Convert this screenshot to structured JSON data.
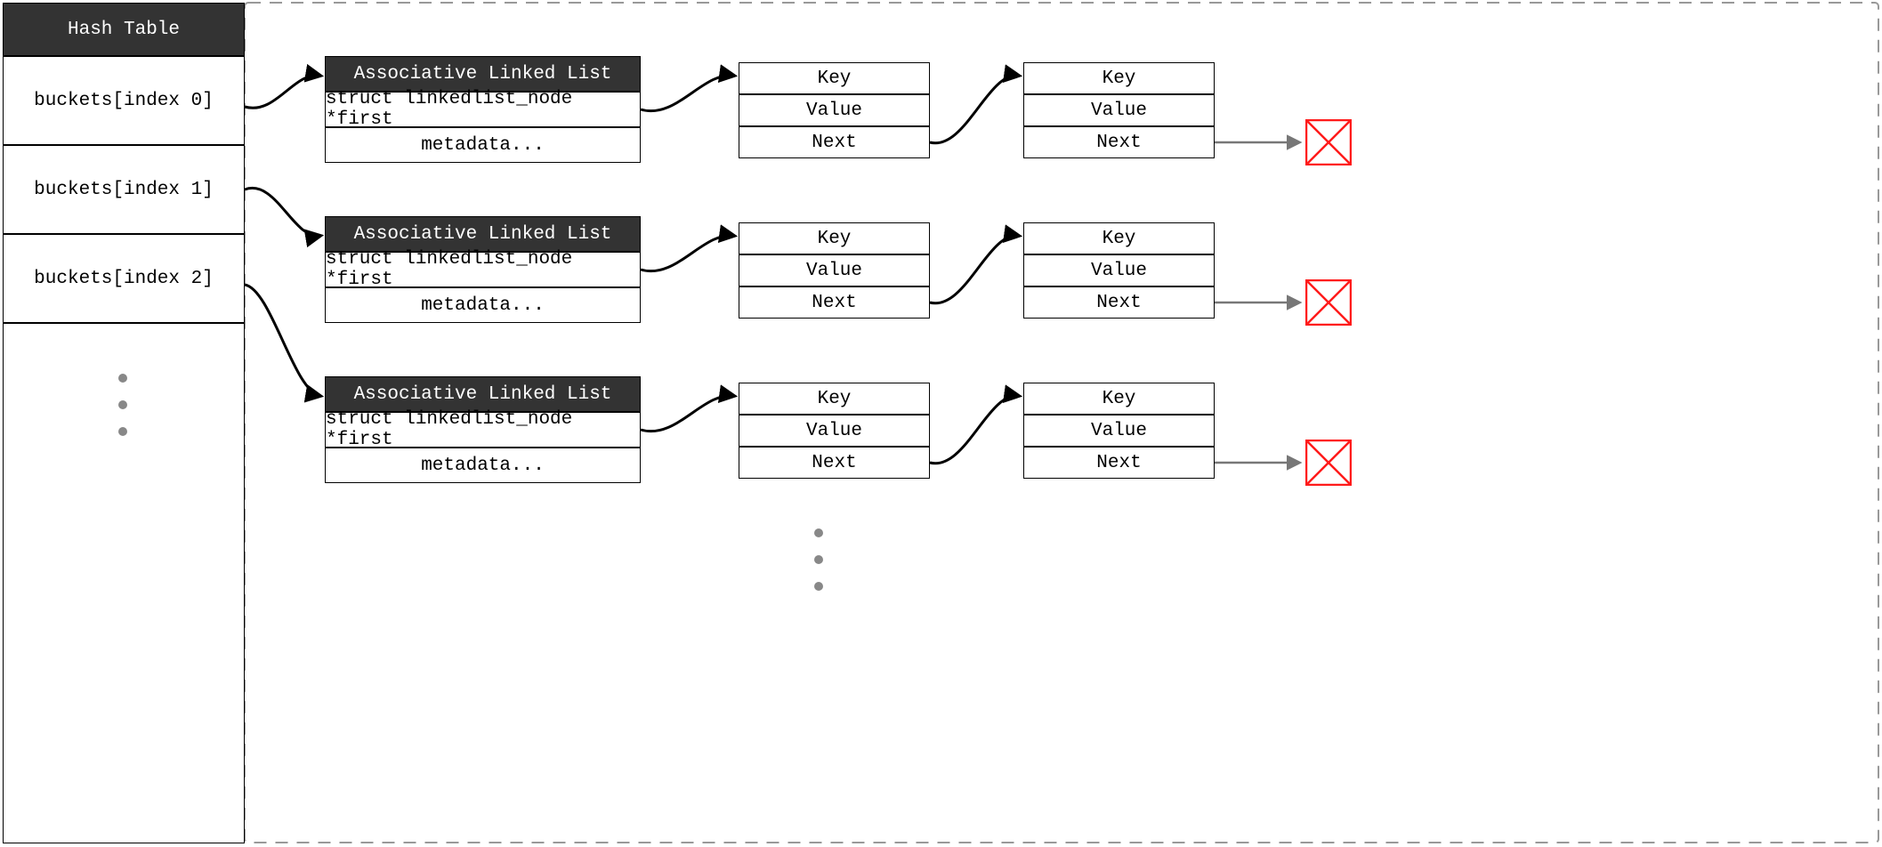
{
  "hash_table": {
    "title": "Hash Table",
    "buckets": [
      "buckets[index 0]",
      "buckets[index 1]",
      "buckets[index 2]"
    ]
  },
  "linked_list": {
    "title": "Associative Linked List",
    "first": "struct linkedlist_node *first",
    "metadata": "metadata..."
  },
  "node": {
    "key": "Key",
    "value": "Value",
    "next": "Next"
  }
}
